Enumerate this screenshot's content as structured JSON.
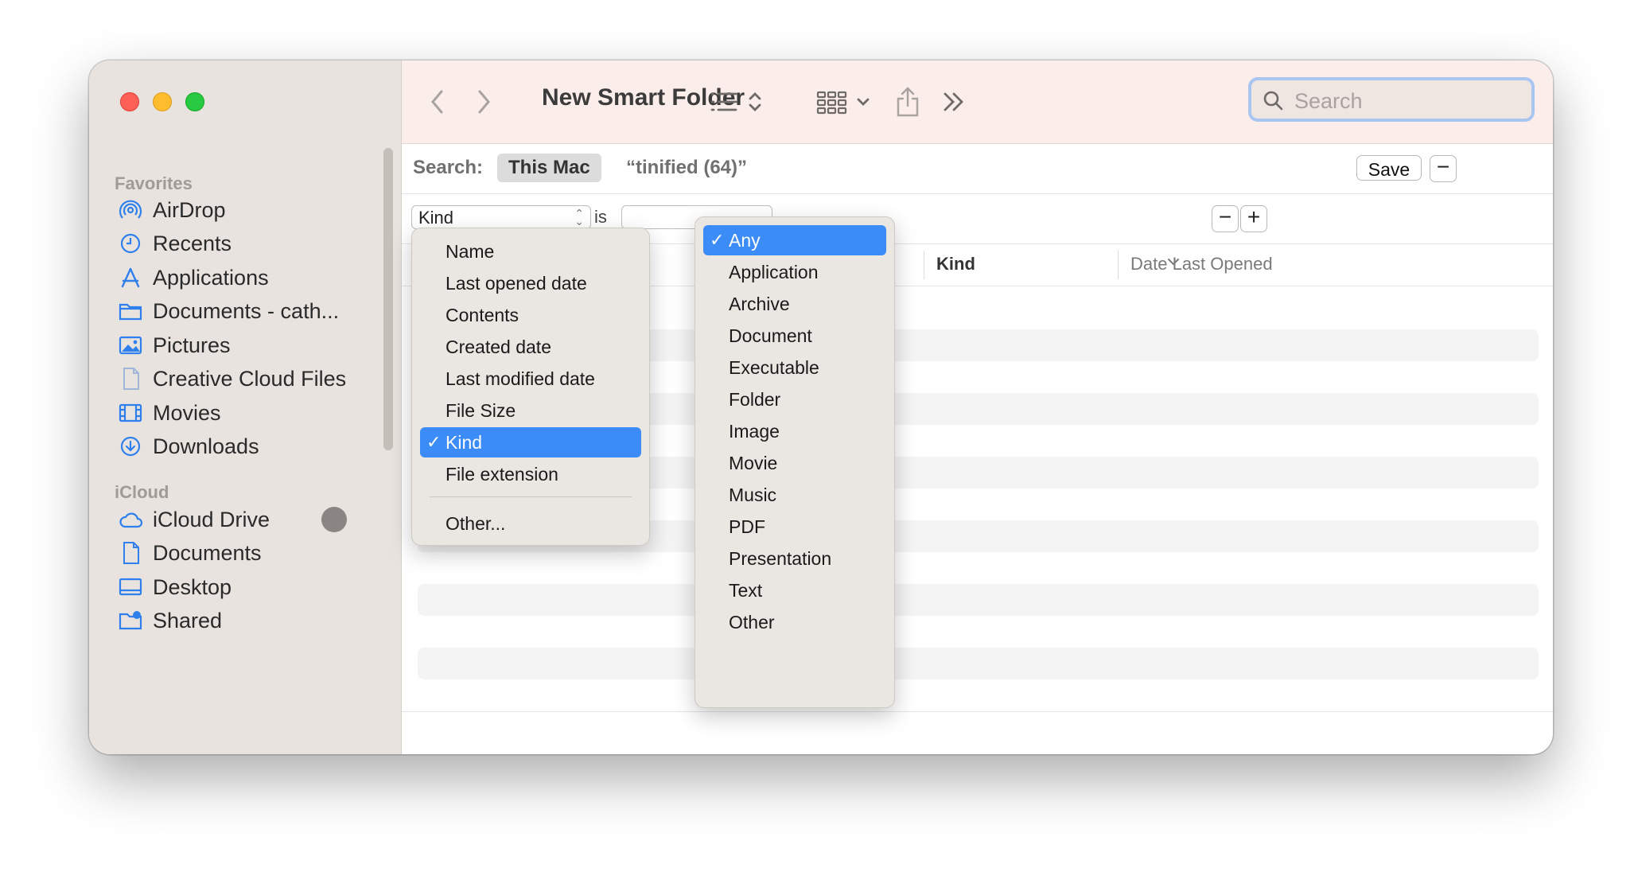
{
  "window": {
    "title": "New Smart Folder"
  },
  "sidebar": {
    "favorites_label": "Favorites",
    "favorites": [
      {
        "label": "AirDrop",
        "icon": "airdrop-icon"
      },
      {
        "label": "Recents",
        "icon": "clock-icon"
      },
      {
        "label": "Applications",
        "icon": "applications-icon"
      },
      {
        "label": "Documents - cath...",
        "icon": "folder-icon"
      },
      {
        "label": "Pictures",
        "icon": "pictures-icon"
      },
      {
        "label": "Creative Cloud Files",
        "icon": "document-icon"
      },
      {
        "label": "Movies",
        "icon": "film-icon"
      },
      {
        "label": "Downloads",
        "icon": "download-icon"
      }
    ],
    "icloud_label": "iCloud",
    "icloud": [
      {
        "label": "iCloud Drive",
        "icon": "cloud-icon"
      },
      {
        "label": "Documents",
        "icon": "document-icon"
      },
      {
        "label": "Desktop",
        "icon": "desktop-icon"
      },
      {
        "label": "Shared",
        "icon": "shared-folder-icon"
      }
    ]
  },
  "toolbar": {
    "search_placeholder": "Search"
  },
  "scope": {
    "label": "Search:",
    "location": "This Mac",
    "query": "“tinified (64)”",
    "save_label": "Save",
    "remove_symbol": "−"
  },
  "criteria": {
    "attribute": "Kind",
    "operator": "is",
    "remove_symbol": "−",
    "add_symbol": "+"
  },
  "columns": {
    "kind": "Kind",
    "date_last_opened": "Date Last Opened"
  },
  "attribute_menu": {
    "items": [
      "Name",
      "Last opened date",
      "Contents",
      "Created date",
      "Last modified date",
      "File Size",
      "Kind",
      "File extension"
    ],
    "selected": "Kind",
    "other": "Other..."
  },
  "kind_menu": {
    "items": [
      "Any",
      "Application",
      "Archive",
      "Document",
      "Executable",
      "Folder",
      "Image",
      "Movie",
      "Music",
      "PDF",
      "Presentation",
      "Text",
      "Other"
    ],
    "selected": "Any"
  },
  "colors": {
    "accent": "#3b8cf6",
    "sidebar_icon": "#2f80ed",
    "sidebar_bg": "#e8e3df",
    "toolbar_bg": "#fbeeea"
  }
}
